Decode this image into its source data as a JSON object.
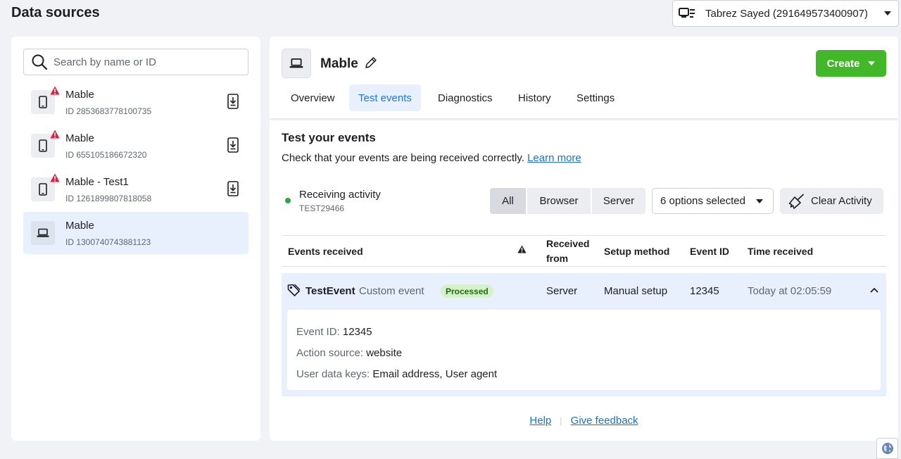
{
  "page": {
    "title": "Data sources"
  },
  "account": {
    "name": "Tabrez Sayed (291649573400907)",
    "icon": "business-manager-icon"
  },
  "sidebar": {
    "search_placeholder": "Search by name or ID",
    "items": [
      {
        "name": "Mable",
        "id": "ID 2853683778100735",
        "device": "phone-icon",
        "warning": true,
        "selected": false
      },
      {
        "name": "Mable",
        "id": "ID 655105186672320",
        "device": "phone-icon",
        "warning": true,
        "selected": false
      },
      {
        "name": "Mable - Test1",
        "id": "ID 1261899807818058",
        "device": "phone-icon",
        "warning": true,
        "selected": false
      },
      {
        "name": "Mable",
        "id": "ID 1300740743881123",
        "device": "laptop-icon",
        "warning": false,
        "selected": true
      }
    ]
  },
  "main": {
    "name": "Mable",
    "create_label": "Create",
    "tabs": [
      {
        "label": "Overview",
        "active": false
      },
      {
        "label": "Test events",
        "active": true
      },
      {
        "label": "Diagnostics",
        "active": false
      },
      {
        "label": "History",
        "active": false
      },
      {
        "label": "Settings",
        "active": false
      }
    ],
    "section_title": "Test your events",
    "section_desc": "Check that your events are being received correctly.",
    "learn_more": "Learn more",
    "activity": {
      "label": "Receiving activity",
      "code": "TEST29466",
      "status_color": "#31a24c"
    },
    "filters": {
      "all": "All",
      "browser": "Browser",
      "server": "Server",
      "active": "All"
    },
    "options_label": "6 options selected",
    "clear_label": "Clear Activity",
    "table": {
      "headers": {
        "events": "Events received",
        "received_from_1": "Received",
        "received_from_2": "from",
        "setup": "Setup method",
        "event_id": "Event ID",
        "time": "Time received"
      },
      "row": {
        "name": "TestEvent",
        "type": "Custom event",
        "status": "Processed",
        "received_from": "Server",
        "setup": "Manual setup",
        "event_id": "12345",
        "time": "Today at 02:05:59",
        "details": [
          {
            "label": "Event ID:",
            "value": "12345"
          },
          {
            "label": "Action source:",
            "value": "website"
          },
          {
            "label": "User data keys:",
            "value": "Email address, User agent"
          }
        ]
      }
    }
  },
  "footer": {
    "help": "Help",
    "feedback": "Give feedback"
  },
  "colors": {
    "accent": "#1877f2",
    "create": "#42b72a",
    "selected_bg": "#e7f0fc",
    "warning": "#e41e3f",
    "processed_bg": "#d6f0c9"
  }
}
